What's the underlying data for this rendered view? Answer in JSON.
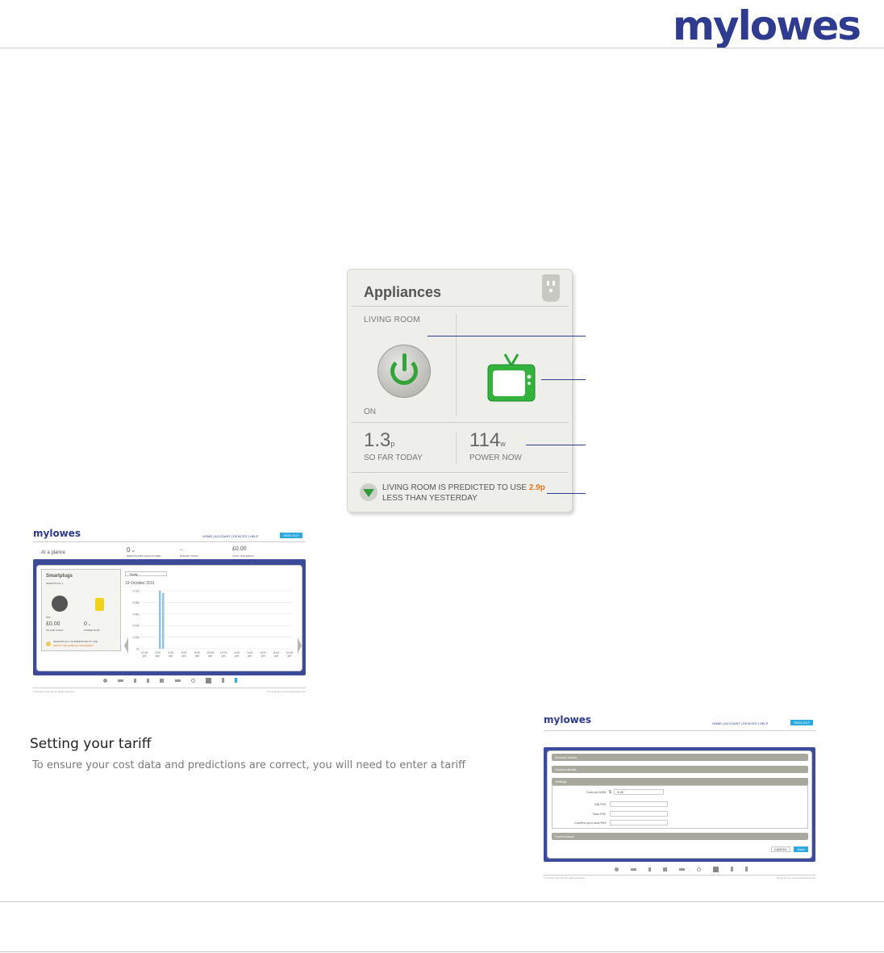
{
  "header": {
    "logo_my": "my",
    "logo_lowes": "lowes"
  },
  "widget": {
    "title": "Appliances",
    "room": "LIVING ROOM",
    "status": "ON",
    "cost_value": "1.3",
    "cost_unit": "p",
    "cost_caption": "SO FAR TODAY",
    "power_value": "114",
    "power_unit": "w",
    "power_caption": "POWER NOW",
    "predict_pre": "LIVING ROOM IS PREDICTED TO USE ",
    "predict_amount": "2.9p",
    "predict_post": " LESS THAN YESTERDAY",
    "colors": {
      "accent_green": "#33a43a",
      "highlight_orange": "#e8741e",
      "callout_blue": "#2e3b8f"
    }
  },
  "dashboard": {
    "logo": "mylowes",
    "nav": [
      "HOME",
      "ACCOUNT",
      "DEVICES",
      "HELP"
    ],
    "sign_out": "SIGN OUT",
    "at_a_glance": "At a glance",
    "glance_power": "0",
    "glance_power_unit": "w",
    "glance_power_label": "REMOTE APPLIANCE POWER",
    "glance_budget": "--",
    "glance_budget_label": "BUDGET TODAY",
    "glance_cost": "£0.00",
    "glance_cost_label": "COST YESTERDAY",
    "panel_title": "Smartplugs",
    "panel_sub": "SMARTPLUG 1",
    "panel_off": "OFF",
    "panel_cost": "£0.00",
    "panel_cost_label": "SO FAR TODAY",
    "panel_power": "0",
    "panel_power_unit": "w",
    "panel_power_label": "POWER NOW",
    "panel_note": "SMARTPLUG 1 IS PREDICTED TO USE",
    "panel_note_hl": "ABOUT THE SAME AS YESTERDAY",
    "select": "Today",
    "date": "19 October 2011",
    "y_ticks": [
      "0.10c",
      "0.08c",
      "0.06c",
      "0.04c",
      "0.02c",
      "0c"
    ],
    "x_ticks": [
      "12:00 pm",
      "2:00 am",
      "4:00 am",
      "6:00 am",
      "8:00 am",
      "10:00 am",
      "12:00 pm",
      "2:00 pm",
      "4:00 pm",
      "6:00 pm",
      "8:00 pm",
      "10:00 pm"
    ],
    "footer_left": "© Current Cost Ltd. All rights reserved.",
    "footer_right": "Terms of use  |  www.currentcost.com"
  },
  "tariff": {
    "heading": "Setting your tariff",
    "body": "To ensure your cost data and predictions are correct, you will need to enter a tariff"
  },
  "settings": {
    "logo": "mylowes",
    "nav": [
      "HOME",
      "ACCOUNT",
      "DEVICES",
      "HELP"
    ],
    "sign_out": "SIGN OUT",
    "sections": [
      "Account details",
      "Contact details",
      "Settings",
      "Control plans"
    ],
    "cost_label": "Cost per kWh",
    "cost_currency": "$",
    "cost_value": "0.15",
    "old_pin": "Old PIN",
    "new_pin": "New PIN",
    "confirm_pin": "Confirm your new PIN",
    "cancel": "CANCEL",
    "save": "Save",
    "footer_left": "© Current Cost Ltd. All rights reserved.",
    "footer_right": "Terms of use  |  www.currentcost.com"
  }
}
